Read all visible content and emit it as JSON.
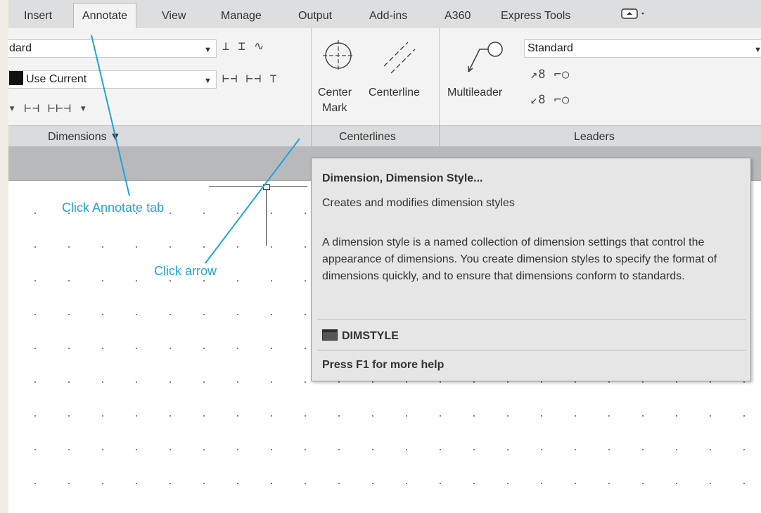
{
  "tabs": [
    "Insert",
    "Annotate",
    "View",
    "Manage",
    "Output",
    "Add-ins",
    "A360",
    "Express Tools"
  ],
  "active_tab": "Annotate",
  "dimensions_panel": {
    "style_value": "dard",
    "layer_value": "Use Current",
    "footer_label": "Dimensions ▼"
  },
  "centerlines_panel": {
    "center_mark_label_1": "Center",
    "center_mark_label_2": "Mark",
    "centerline_label": "Centerline",
    "footer_label": "Centerlines"
  },
  "leaders_panel": {
    "multileader_label": "Multileader",
    "style_value": "Standard",
    "footer_label": "Leaders"
  },
  "tooltip": {
    "title": "Dimension, Dimension Style...",
    "subtitle": "Creates and modifies dimension styles",
    "body": "A dimension style is a named collection of dimension settings that control the appearance of dimensions. You create dimension styles to specify the format of dimensions quickly, and to ensure that dimensions conform to standards.",
    "command": "DIMSTYLE",
    "help": "Press F1 for more help"
  },
  "callouts": {
    "annotate_tab": "Click Annotate tab",
    "arrow": "Click arrow"
  },
  "colors": {
    "callout": "#1ea4e0",
    "ribbon_bg": "#f3f3f3",
    "tab_bar": "#dcdedf"
  },
  "icons": [
    "center-mark-icon",
    "centerline-icon",
    "multileader-icon",
    "panel-launcher-icon",
    "dimstyle-command-icon",
    "quick-access-icon"
  ]
}
